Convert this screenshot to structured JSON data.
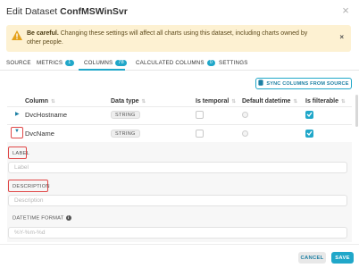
{
  "dialog": {
    "title_prefix": "Edit Dataset ",
    "title_name": "ConfMSWinSvr",
    "close_glyph": "×"
  },
  "alert": {
    "bold_text": "Be careful.",
    "text": " Changing these settings will affect all charts using this dataset, including charts owned by other people.",
    "close_glyph": "×",
    "icon": "warning-icon",
    "icon_color": "#e4a11b"
  },
  "tabs": [
    {
      "label": "SOURCE"
    },
    {
      "label": "METRICS",
      "badge": "1"
    },
    {
      "label": "COLUMNS",
      "badge": "78"
    },
    {
      "label": "CALCULATED COLUMNS",
      "badge": "0"
    },
    {
      "label": "SETTINGS"
    }
  ],
  "sync_button": {
    "label": "SYNC COLUMNS FROM SOURCE",
    "icon": "database-icon"
  },
  "table": {
    "headers": [
      "Column",
      "Data type",
      "Is temporal",
      "Default datetime",
      "Is filterable"
    ],
    "rows": [
      {
        "name": "DvcHostname",
        "type": "STRING",
        "is_temporal": false,
        "is_filterable": true,
        "expanded": false
      },
      {
        "name": "DvcName",
        "type": "STRING",
        "is_temporal": false,
        "is_filterable": true,
        "expanded": true
      }
    ]
  },
  "expanded_fields": {
    "label_title": "LABEL",
    "label_placeholder": "Label",
    "description_title": "DESCRIPTION",
    "description_placeholder": "Description",
    "datetime_title": "DATETIME FORMAT",
    "datetime_placeholder": "%Y-%m-%d"
  },
  "footer": {
    "cancel_label": "CANCEL",
    "save_label": "SAVE"
  },
  "colors": {
    "accent": "#20a7c9",
    "warning_bg": "#fdf1d2",
    "highlight_box": "#e04848"
  }
}
